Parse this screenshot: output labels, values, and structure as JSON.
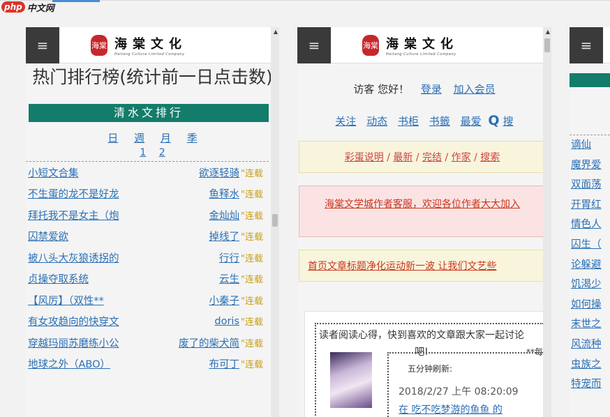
{
  "watermark": {
    "logo": "php",
    "text": "中文网"
  },
  "brand": {
    "seal": "海棠",
    "name": "海棠文化",
    "tagline": "Haitang Culture Limited Company"
  },
  "icons": {
    "menu": "hamburger-icon",
    "search": "search-icon"
  },
  "colors": {
    "teal": "#147c6a",
    "link": "#2a6fb5",
    "serial": "#c8a018"
  },
  "panel1": {
    "title": "热门排行榜(统计前一日点击数)",
    "section": "清水文排行",
    "periods": [
      "日",
      "週",
      "月",
      "季"
    ],
    "pages": [
      "1",
      "2"
    ],
    "rows": [
      {
        "title": "小短文合集",
        "author": "欲逐轻骑",
        "status": "\"连载"
      },
      {
        "title": "不生蛋的龙不是好龙",
        "author": "鱼释水",
        "status": "\"连载"
      },
      {
        "title": "拜托我不是女主（炮",
        "author": "金灿灿",
        "status": "\"连载"
      },
      {
        "title": "囚禁爱欲",
        "author": "掉线了",
        "status": "\"连载"
      },
      {
        "title": "被八头大灰狼诱拐的",
        "author": "行行",
        "status": "\"连载"
      },
      {
        "title": "贞操夺取系统",
        "author": "云生",
        "status": "\"连载"
      },
      {
        "title": "【风厉】（双性**",
        "author": "小秦子",
        "status": "\"连载"
      },
      {
        "title": "有女攻趋向的快穿文",
        "author": "doris",
        "status": "\"连载"
      },
      {
        "title": "穿越玛丽苏磨练小公",
        "author": "废了的柴犬简",
        "status": "\"连载"
      },
      {
        "title": "地球之外（ABO）",
        "author": "布可丁",
        "status": "\"连载"
      }
    ]
  },
  "panel2": {
    "greeting": "访客 您好！",
    "login": "登录",
    "join": "加入会员",
    "nav": [
      "关注",
      "动态",
      "书柜",
      "书籤",
      "最爱"
    ],
    "search_label": "搜",
    "yellow_links": [
      "彩蛋说明",
      "最新",
      "完结",
      "作家",
      "搜索"
    ],
    "red_notice": "海棠文学城作者客服，欢迎各位作者大大加入",
    "notice2": "首页文章标题净化运动新一波 让我们文艺些",
    "read_text": "读者阅读心得，快到喜欢的文章跟大家一起讨论吧!",
    "read_refresh": "**每五分钟刷新:",
    "chat_time": "2018/2/27 上午 08:20:09",
    "chat_msg": "在 吃不吃梦游的鱼鱼 的"
  },
  "panel3": {
    "rows": [
      "谪仙",
      "魔界爱",
      "双面荡",
      "开胃红",
      "情色人",
      "囚生（",
      "论躲避",
      "饥渴少",
      "如何操",
      "末世之",
      "风流种",
      "虫族之",
      "特宠而"
    ]
  }
}
